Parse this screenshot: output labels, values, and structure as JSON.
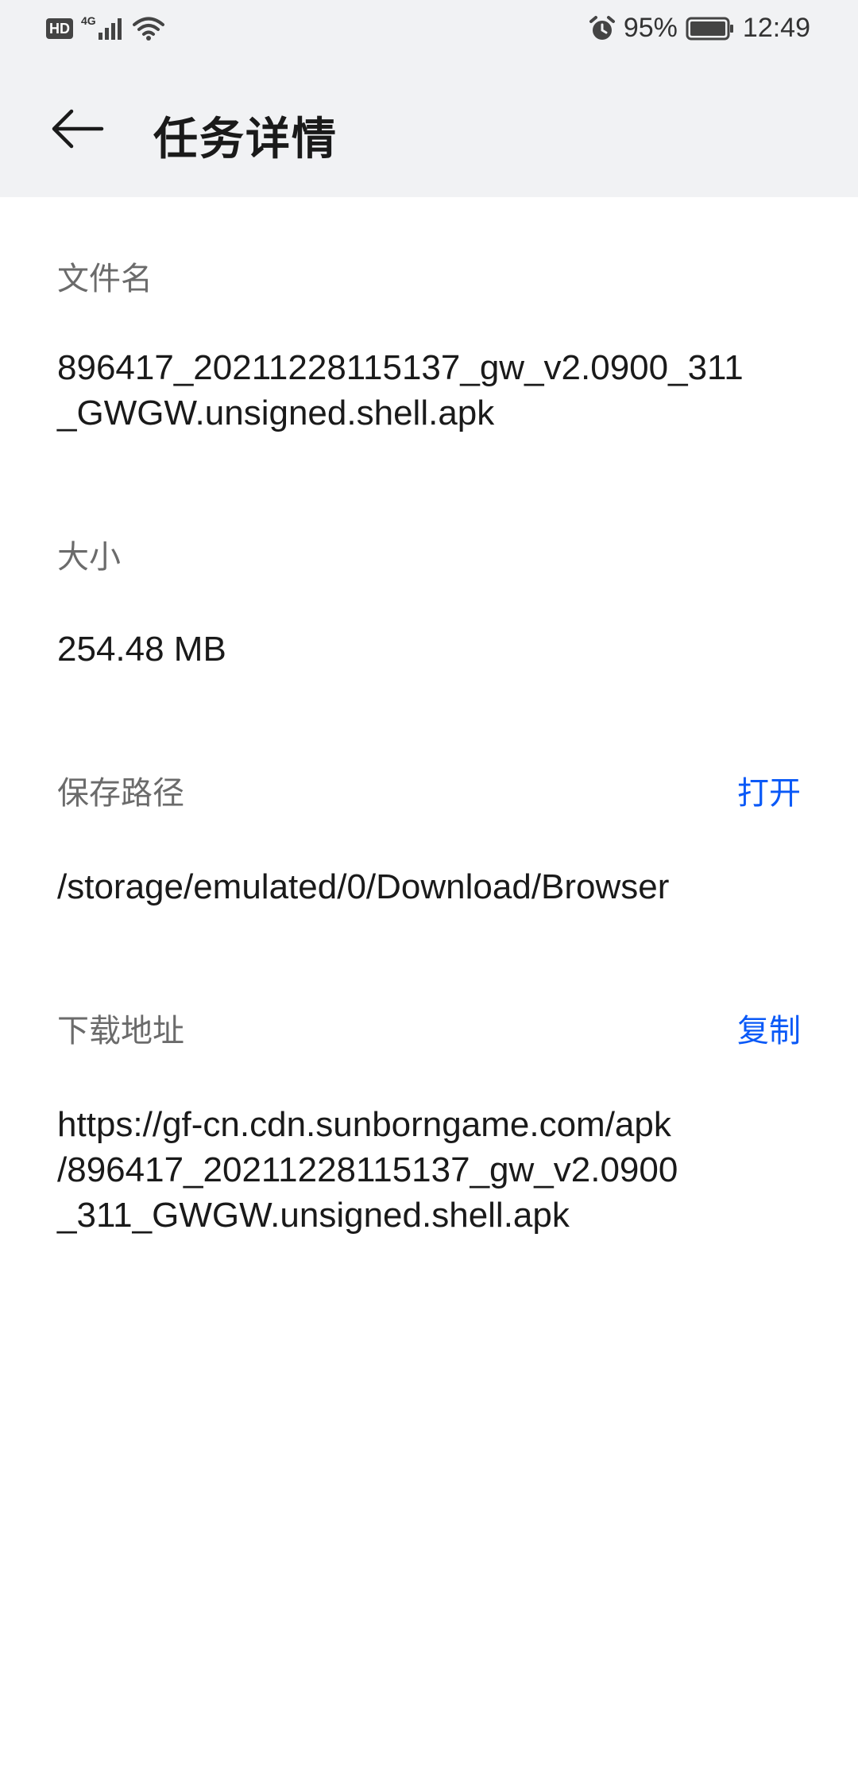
{
  "status_bar": {
    "hd_badge": "HD",
    "network_type": "4G",
    "battery_percent": "95%",
    "time": "12:49",
    "icons": [
      "hd-icon",
      "signal-icon",
      "wifi-icon",
      "alarm-icon",
      "battery-icon"
    ]
  },
  "header": {
    "back_icon": "arrow-left-icon",
    "title": "任务详情"
  },
  "details": {
    "file_name_label": "文件名",
    "file_name_line1": "896417_20211228115137_gw_v2.0900_311",
    "file_name_line2": "_GWGW.unsigned.shell.apk",
    "size_label": "大小",
    "size_value": "254.48 MB",
    "save_path_label": "保存路径",
    "open_action": "打开",
    "save_path_value": "/storage/emulated/0/Download/Browser",
    "download_url_label": "下载地址",
    "copy_action": "复制",
    "download_url_line1": "https://gf-cn.cdn.sunborngame.com/apk",
    "download_url_line2": "/896417_20211228115137_gw_v2.0900",
    "download_url_line3": "_311_GWGW.unsigned.shell.apk"
  },
  "colors": {
    "accent": "#0a59f7",
    "header_bg": "#f1f2f4",
    "label": "#6b6b6b",
    "text": "#1a1a1a"
  }
}
